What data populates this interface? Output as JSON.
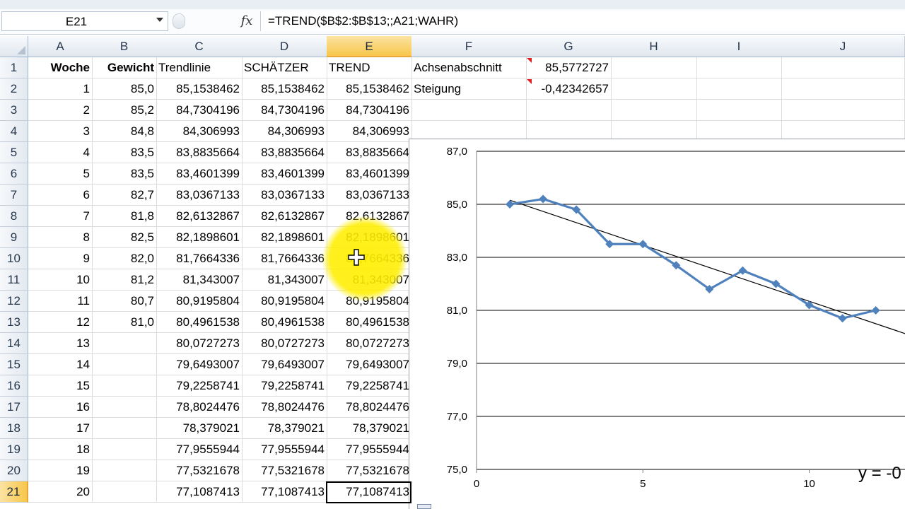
{
  "name_box": "E21",
  "formula": "=TREND($B$2:$B$13;;A21;WAHR)",
  "fx_label": "fx",
  "columns": [
    "A",
    "B",
    "C",
    "D",
    "E",
    "F",
    "G",
    "H",
    "I",
    "J"
  ],
  "selected_column": "E",
  "rows": [
    "1",
    "2",
    "3",
    "4",
    "5",
    "6",
    "7",
    "8",
    "9",
    "10",
    "11",
    "12",
    "13",
    "14",
    "15",
    "16",
    "17",
    "18",
    "19",
    "20",
    "21"
  ],
  "selected_row": "21",
  "headers": {
    "A": "Woche",
    "B": "Gewicht",
    "C": "Trendlinie",
    "D": "SCHÄTZER",
    "E": "TREND",
    "F": "Achsenabschnitt",
    "G": "85,5772727"
  },
  "row2_extra": {
    "F": "Steigung",
    "G": "-0,42342657"
  },
  "table": [
    [
      "1",
      "85,0",
      "85,1538462",
      "85,1538462",
      "85,1538462"
    ],
    [
      "2",
      "85,2",
      "84,7304196",
      "84,7304196",
      "84,7304196"
    ],
    [
      "3",
      "84,8",
      "84,306993",
      "84,306993",
      "84,306993"
    ],
    [
      "4",
      "83,5",
      "83,8835664",
      "83,8835664",
      "83,8835664"
    ],
    [
      "5",
      "83,5",
      "83,4601399",
      "83,4601399",
      "83,4601399"
    ],
    [
      "6",
      "82,7",
      "83,0367133",
      "83,0367133",
      "83,0367133"
    ],
    [
      "7",
      "81,8",
      "82,6132867",
      "82,6132867",
      "82,6132867"
    ],
    [
      "8",
      "82,5",
      "82,1898601",
      "82,1898601",
      "82,1898601"
    ],
    [
      "9",
      "82,0",
      "81,7664336",
      "81,7664336",
      "81,7664336"
    ],
    [
      "10",
      "81,2",
      "81,343007",
      "81,343007",
      "81,343007"
    ],
    [
      "11",
      "80,7",
      "80,9195804",
      "80,9195804",
      "80,9195804"
    ],
    [
      "12",
      "81,0",
      "80,4961538",
      "80,4961538",
      "80,4961538"
    ],
    [
      "13",
      "",
      "80,0727273",
      "80,0727273",
      "80,0727273"
    ],
    [
      "14",
      "",
      "79,6493007",
      "79,6493007",
      "79,6493007"
    ],
    [
      "15",
      "",
      "79,2258741",
      "79,2258741",
      "79,2258741"
    ],
    [
      "16",
      "",
      "78,8024476",
      "78,8024476",
      "78,8024476"
    ],
    [
      "17",
      "",
      "78,379021",
      "78,379021",
      "78,379021"
    ],
    [
      "18",
      "",
      "77,9555944",
      "77,9555944",
      "77,9555944"
    ],
    [
      "19",
      "",
      "77,5321678",
      "77,5321678",
      "77,5321678"
    ],
    [
      "20",
      "",
      "77,1087413",
      "77,1087413",
      "77,1087413"
    ]
  ],
  "colors": {
    "series": "#4f81bd",
    "trendline": "#000000",
    "highlight": "#ffee00",
    "selected_header": "#f8c74b"
  },
  "chart_data": {
    "type": "scatter",
    "x": [
      1,
      2,
      3,
      4,
      5,
      6,
      7,
      8,
      9,
      10,
      11,
      12
    ],
    "series": [
      {
        "values": [
          85.0,
          85.2,
          84.8,
          83.5,
          83.5,
          82.7,
          81.8,
          82.5,
          82.0,
          81.2,
          80.7,
          81.0
        ]
      }
    ],
    "trendline": {
      "intercept": 85.5772727,
      "slope": -0.42342657
    },
    "xlim": [
      0,
      12.9
    ],
    "ylim": [
      75,
      87
    ],
    "yticks": [
      "75,0",
      "77,0",
      "79,0",
      "81,0",
      "83,0",
      "85,0",
      "87,0"
    ],
    "xticks": [
      "0",
      "5",
      "10"
    ],
    "equation_text": "y = -0",
    "grid": "horizontal major gridlines"
  }
}
